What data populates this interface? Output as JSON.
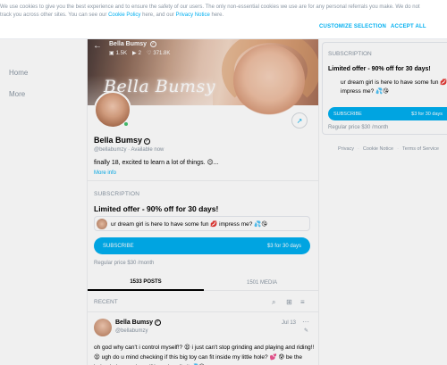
{
  "cookie": {
    "text_1": "We use cookies to give you the best experience and to ensure the safety of our users. The only non-essential cookies we use are for any personal referrals you make. We do not track you across other sites. You can see our ",
    "cookie_policy_link": "Cookie Policy",
    "text_2": " here, and our ",
    "privacy_link": "Privacy Notice",
    "text_3": " here.",
    "customize_label": "CUSTOMIZE SELECTION",
    "accept_label": "ACCEPT ALL"
  },
  "nav": {
    "home": "Home",
    "more": "More"
  },
  "profile": {
    "cover_name": "Bella Bumsy",
    "cover_script": "Bella Bumsy",
    "stats": {
      "photos": "1.5K",
      "videos": "2",
      "likes": "371.8K"
    },
    "name": "Bella Bumsy",
    "handle": "@bellabumzy",
    "status": "Available now",
    "bio": "finally 18, excited to learn a lot of things. 😉...",
    "more_info": "More info"
  },
  "subscription": {
    "label": "SUBSCRIPTION",
    "offer": "Limited offer - 90% off for 30 days!",
    "message": "ur dream girl is here to have some fun 💋 impress me? 💦😘",
    "button_label": "SUBSCRIBE",
    "button_price": "$3 for 30 days",
    "regular_price": "Regular price $30 /month"
  },
  "tabs": [
    {
      "label": "1533 POSTS"
    },
    {
      "label": "1501 MEDIA"
    }
  ],
  "feed": {
    "recent_label": "RECENT",
    "post": {
      "author": "Bella Bumsy",
      "handle": "@bellabumzy",
      "date": "Jul 13",
      "text": "oh god why can't i control myself!? 😫 i just can't stop grinding and playing and riding!! 😫 ugh do u mind checking if this big toy can fit inside my little hole? 💕 😰 be the judge babes and see if i can handle it 💦😘"
    }
  },
  "sidebar_card": {
    "label": "SUBSCRIPTION",
    "offer": "Limited offer - 90% off for 30 days!",
    "message": "ur dream girl is here to have some fun 💋 impress me? 💦😘",
    "button_label": "SUBSCRIBE",
    "button_price": "$3 for 30 days",
    "regular_price": "Regular price $30 /month"
  },
  "footer": {
    "privacy": "Privacy",
    "cookie_notice": "Cookie Notice",
    "terms": "Terms of Service"
  },
  "colors": {
    "accent": "#00aff0",
    "muted": "#8a96a3",
    "online": "#46c36f"
  },
  "icons": [
    "back-arrow-icon",
    "verified-icon",
    "image-icon",
    "video-icon",
    "heart-icon",
    "share-icon",
    "search-icon",
    "grid-icon",
    "sort-icon",
    "more-icon",
    "pin-icon"
  ]
}
